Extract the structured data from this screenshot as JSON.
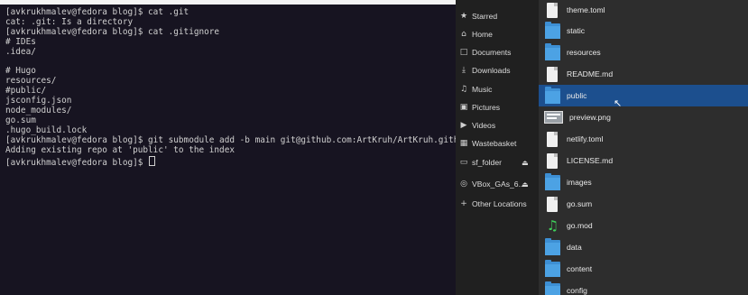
{
  "terminal": {
    "lines": [
      "[avkrukhmalev@fedora blog]$ cat .git",
      "cat: .git: Is a directory",
      "[avkrukhmalev@fedora blog]$ cat .gitignore",
      "# IDEs",
      ".idea/",
      "",
      "# Hugo",
      "resources/",
      "#public/",
      "jsconfig.json",
      "node_modules/",
      "go.sum",
      ".hugo_build.lock",
      "[avkrukhmalev@fedora blog]$ git submodule add -b main git@github.com:ArtKruh/ArtKruh.github.io",
      "Adding existing repo at 'public' to the index"
    ],
    "prompt": "[avkrukhmalev@fedora blog]$ "
  },
  "sidebar": {
    "items": [
      {
        "label": "Starred",
        "icon": "star-icon"
      },
      {
        "label": "Home",
        "icon": "home-icon"
      },
      {
        "label": "Documents",
        "icon": "document-icon"
      },
      {
        "label": "Downloads",
        "icon": "download-icon"
      },
      {
        "label": "Music",
        "icon": "music-icon"
      },
      {
        "label": "Pictures",
        "icon": "pictures-icon"
      },
      {
        "label": "Videos",
        "icon": "video-icon"
      },
      {
        "label": "Wastebasket",
        "icon": "trash-icon"
      },
      {
        "label": "sf_folder",
        "icon": "drive-icon",
        "eject": true
      },
      {
        "label": "VBox_GAs_6....",
        "icon": "disc-icon",
        "eject": true
      },
      {
        "label": "Other Locations",
        "icon": "plus-icon"
      }
    ]
  },
  "files": [
    {
      "name": "theme.toml",
      "type": "doc"
    },
    {
      "name": "static",
      "type": "folder"
    },
    {
      "name": "resources",
      "type": "folder"
    },
    {
      "name": "README.md",
      "type": "doc"
    },
    {
      "name": "public",
      "type": "folder",
      "selected": true
    },
    {
      "name": "preview.png",
      "type": "image"
    },
    {
      "name": "netlify.toml",
      "type": "doc"
    },
    {
      "name": "LICENSE.md",
      "type": "doc"
    },
    {
      "name": "images",
      "type": "folder"
    },
    {
      "name": "go.sum",
      "type": "doc"
    },
    {
      "name": "go.mod",
      "type": "music"
    },
    {
      "name": "data",
      "type": "folder"
    },
    {
      "name": "content",
      "type": "folder"
    },
    {
      "name": "config",
      "type": "folder"
    }
  ],
  "colors": {
    "terminal_bg": "#171421",
    "sidebar_bg": "#202020",
    "filelist_bg": "#2d2d2d",
    "selection": "#1c4f8e",
    "folder": "#4ca2e4"
  }
}
